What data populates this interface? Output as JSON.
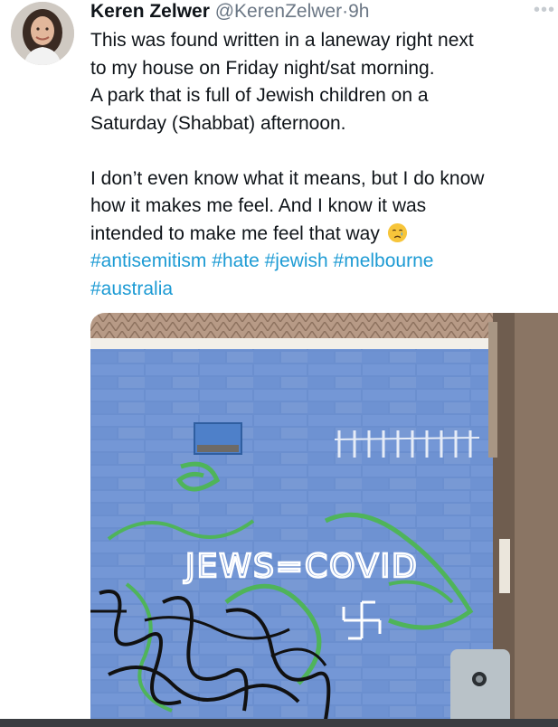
{
  "tweet": {
    "display_name": "Keren Zelwer",
    "handle": "@KerenZelwer",
    "separator": "·",
    "time": "9h",
    "more_icon": "more-dots-icon",
    "text_lines": [
      "This was found written in a laneway right next",
      "to my house on Friday night/sat morning.",
      "A park that is full of Jewish children on a",
      "Saturday (Shabbat) afternoon.",
      "I don’t even know what it means, but I do know",
      "how it makes me feel.  And I know it was",
      "intended to make me feel that way"
    ],
    "emoji": "crying-face-icon",
    "hashtags_line1": [
      "#antisemitism",
      "#hate",
      "#jewish",
      "#melbourne"
    ],
    "hashtags_line2": [
      "#australia"
    ],
    "hashtag_color": "#1d9bd4"
  },
  "media": {
    "graffiti_text": "JEWS=COVID",
    "wall_color": "#6b8fcf"
  }
}
